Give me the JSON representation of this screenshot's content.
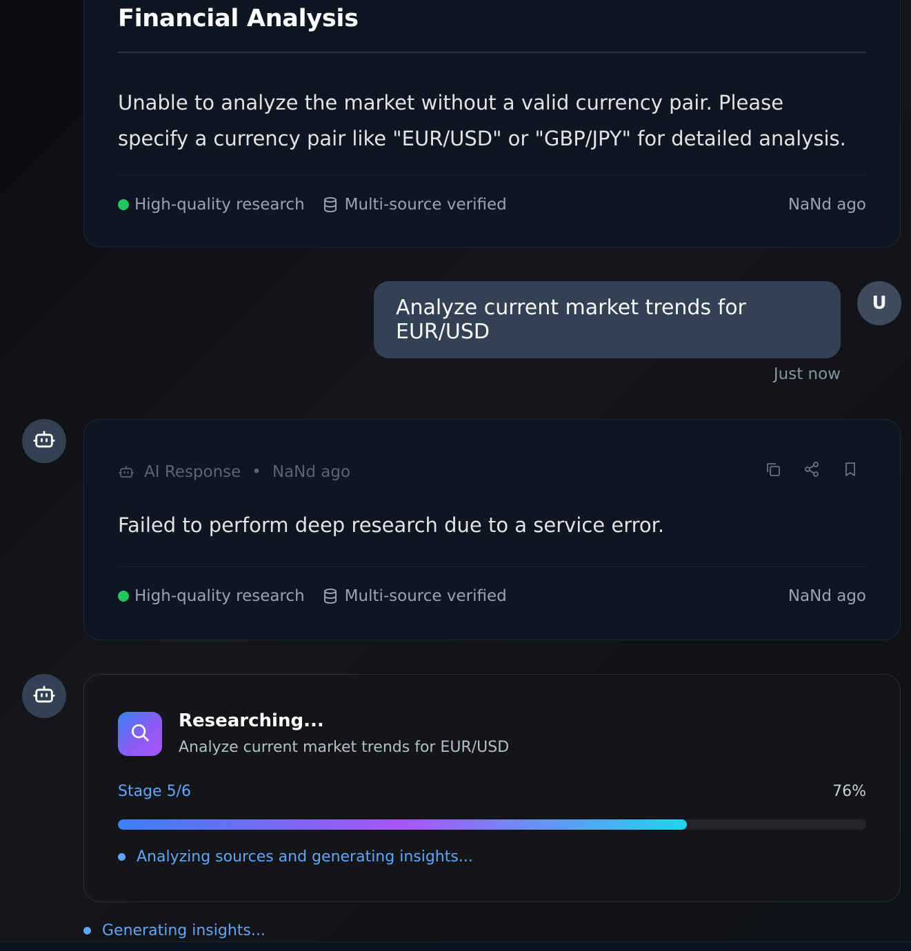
{
  "colors": {
    "user_bubble": "#334155",
    "accent_blue": "#60a5fa",
    "quality_dot": "#22c55e",
    "progress_gradient": [
      "#3b82f6",
      "#a855f7",
      "#22d3ee"
    ]
  },
  "previous_response": {
    "title": "Financial Analysis",
    "body": "Unable to analyze the market without a valid currency pair. Please specify a currency pair like \"EUR/USD\" or \"GBP/JPY\" for detailed analysis.",
    "quality_label": "High-quality research",
    "verified_icon": "database-icon",
    "verified_label": "Multi-source verified",
    "time": "NaNd ago"
  },
  "user_message": {
    "avatar_letter": "U",
    "text": "Analyze current market trends for EUR/USD",
    "time": "Just now"
  },
  "ai_response": {
    "avatar_icon": "bot-icon",
    "label": "AI Response",
    "separator": "•",
    "meta_time": "NaNd ago",
    "actions": [
      {
        "icon": "copy-icon"
      },
      {
        "icon": "share-icon"
      },
      {
        "icon": "bookmark-icon"
      }
    ],
    "body": "Failed to perform deep research due to a service error.",
    "quality_label": "High-quality research",
    "verified_icon": "database-icon",
    "verified_label": "Multi-source verified",
    "time": "NaNd ago"
  },
  "research": {
    "avatar_icon": "bot-icon",
    "badge_icon": "search-icon",
    "title": "Researching...",
    "query": "Analyze current market trends for EUR/USD",
    "stage_label": "Stage 5/6",
    "percent_label": "76%",
    "progress_fraction": 0.76,
    "status": "Analyzing sources and generating insights..."
  },
  "footer_status": "Generating insights..."
}
